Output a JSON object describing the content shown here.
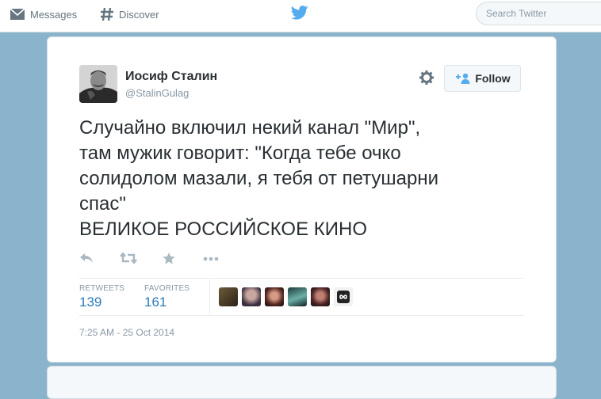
{
  "topbar": {
    "messages_label": "Messages",
    "discover_label": "Discover",
    "search_placeholder": "Search Twitter"
  },
  "tweet": {
    "author_name": "Иосиф Сталин",
    "author_handle": "@StalinGulag",
    "follow_label": "Follow",
    "text_lines": [
      "Случайно включил некий канал \"Мир\",",
      "там мужик говорит: \"Когда тебе очко",
      "солидолом мазали, я тебя от петушарни",
      "спас\"",
      "ВЕЛИКОЕ РОССИЙСКОЕ КИНО"
    ],
    "retweets_label": "RETWEETS",
    "retweets_count": "139",
    "favorites_label": "FAVORITES",
    "favorites_count": "161",
    "timestamp": "7:25 AM - 25 Oct 2014"
  },
  "colors": {
    "accent": "#55acee",
    "link": "#2b7bb9",
    "background": "#8ab4cc"
  },
  "icons": [
    "envelope-icon",
    "hashtag-icon",
    "twitter-bird-icon",
    "gear-icon",
    "add-user-icon",
    "reply-icon",
    "retweet-icon",
    "favorite-star-icon",
    "more-dots-icon"
  ]
}
